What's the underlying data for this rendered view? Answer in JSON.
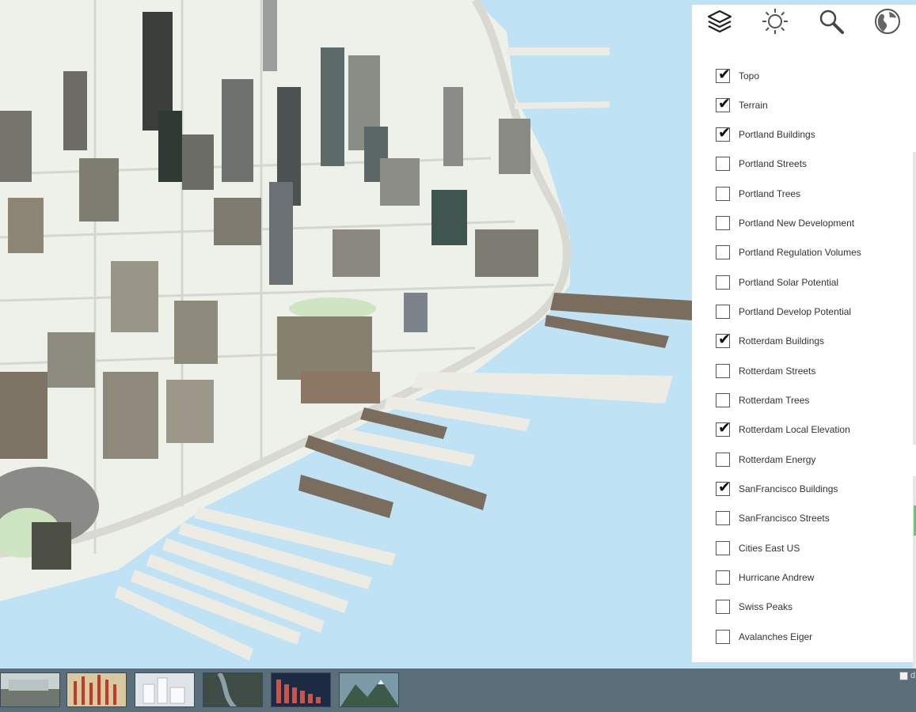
{
  "tabs": [
    {
      "name": "layers-icon",
      "active": true
    },
    {
      "name": "sun-icon",
      "active": false
    },
    {
      "name": "search-icon",
      "active": false
    },
    {
      "name": "globe-icon",
      "active": false
    }
  ],
  "layers": [
    {
      "label": "Topo",
      "checked": true
    },
    {
      "label": "Terrain",
      "checked": true
    },
    {
      "label": "Portland Buildings",
      "checked": true
    },
    {
      "label": "Portland Streets",
      "checked": false
    },
    {
      "label": "Portland Trees",
      "checked": false
    },
    {
      "label": "Portland New Development",
      "checked": false
    },
    {
      "label": "Portland Regulation Volumes",
      "checked": false
    },
    {
      "label": "Portland Solar Potential",
      "checked": false
    },
    {
      "label": "Portland Develop Potential",
      "checked": false
    },
    {
      "label": "Rotterdam Buildings",
      "checked": true
    },
    {
      "label": "Rotterdam Streets",
      "checked": false
    },
    {
      "label": "Rotterdam Trees",
      "checked": false
    },
    {
      "label": "Rotterdam Local Elevation",
      "checked": true
    },
    {
      "label": "Rotterdam Energy",
      "checked": false
    },
    {
      "label": "SanFrancisco Buildings",
      "checked": true
    },
    {
      "label": "SanFrancisco Streets",
      "checked": false
    },
    {
      "label": "Cities East US",
      "checked": false
    },
    {
      "label": "Hurricane Andrew",
      "checked": false
    },
    {
      "label": "Swiss Peaks",
      "checked": false
    },
    {
      "label": "Avalanches Eiger",
      "checked": false
    }
  ],
  "bottom_bar": {
    "thumbnails": [
      "city-aerial-thumbnail",
      "red-extrusion-thumbnail",
      "white-buildings-thumbnail",
      "satellite-thumbnail",
      "bar-columns-thumbnail",
      "mountains-thumbnail"
    ],
    "corner_text": "d"
  },
  "colors": {
    "water": "#bfe3f5",
    "bar": "#5a6f79",
    "panel": "#ffffff"
  }
}
